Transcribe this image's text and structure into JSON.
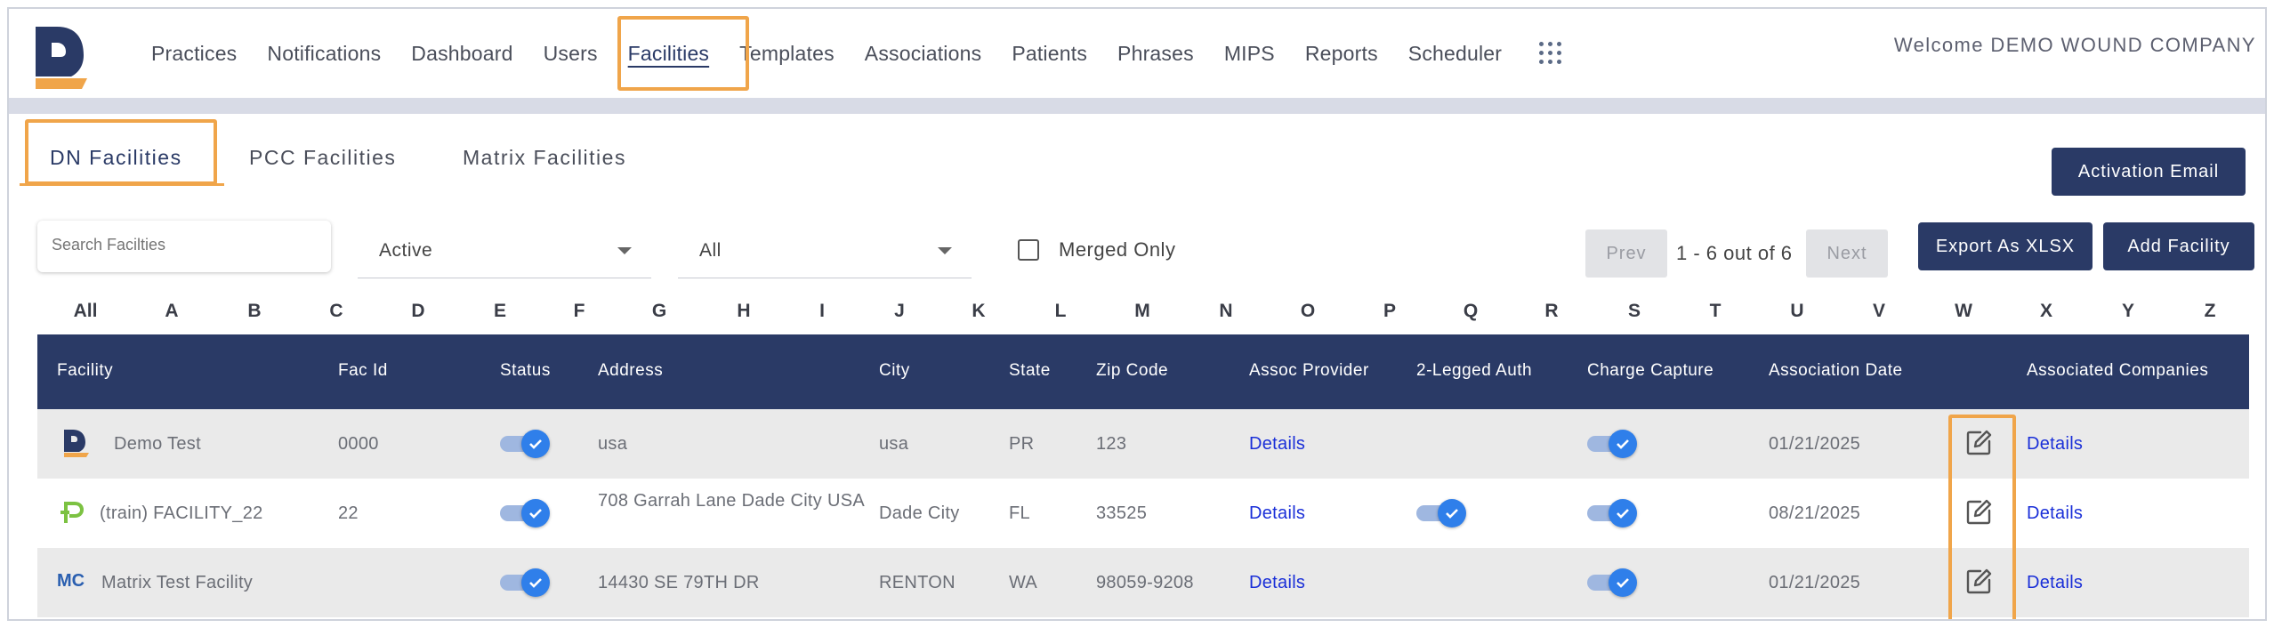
{
  "header": {
    "nav": [
      "Practices",
      "Notifications",
      "Dashboard",
      "Users",
      "Facilities",
      "Templates",
      "Associations",
      "Patients",
      "Phrases",
      "MIPS",
      "Reports",
      "Scheduler"
    ],
    "active_nav": "Facilities",
    "welcome": "Welcome DEMO WOUND COMPANY"
  },
  "tabs": [
    "DN Facilities",
    "PCC Facilities",
    "Matrix Facilities"
  ],
  "active_tab": "DN Facilities",
  "buttons": {
    "activation_email": "Activation Email",
    "export": "Export As XLSX",
    "add_facility": "Add Facility",
    "prev": "Prev",
    "next": "Next"
  },
  "filters": {
    "search_placeholder": "Search Facilties",
    "status_value": "Active",
    "type_value": "All",
    "merged_label": "Merged Only",
    "merged_checked": false
  },
  "pagination": {
    "text": "1 - 6 out of 6"
  },
  "letters": [
    "All",
    "A",
    "B",
    "C",
    "D",
    "E",
    "F",
    "G",
    "H",
    "I",
    "J",
    "K",
    "L",
    "M",
    "N",
    "O",
    "P",
    "Q",
    "R",
    "S",
    "T",
    "U",
    "V",
    "W",
    "X",
    "Y",
    "Z"
  ],
  "table": {
    "columns": [
      "Facility",
      "Fac Id",
      "Status",
      "Address",
      "City",
      "State",
      "Zip Code",
      "Assoc Provider",
      "2-Legged Auth",
      "Charge Capture",
      "Association Date",
      "Associated Companies"
    ],
    "rows": [
      {
        "icon": "dn-logo-icon",
        "facility": "Demo Test",
        "fac_id": "0000",
        "status": true,
        "address": "usa",
        "city": "usa",
        "state": "PR",
        "zip": "123",
        "assoc_provider": "Details",
        "two_legged_auth": false,
        "charge_capture": true,
        "association_date": "01/21/2025",
        "associated_companies": "Details"
      },
      {
        "icon": "pcc-logo-icon",
        "facility": "(train) FACILITY_22",
        "fac_id": "22",
        "status": true,
        "address": "708 Garrah Lane Dade City USA",
        "city": "Dade City",
        "state": "FL",
        "zip": "33525",
        "assoc_provider": "Details",
        "two_legged_auth": true,
        "charge_capture": true,
        "association_date": "08/21/2025",
        "associated_companies": "Details"
      },
      {
        "icon": "matrix-logo-icon",
        "icon_text": "MC",
        "facility": "Matrix Test Facility",
        "fac_id": "",
        "status": true,
        "address": "14430 SE 79TH DR",
        "city": "RENTON",
        "state": "WA",
        "zip": "98059-9208",
        "assoc_provider": "Details",
        "two_legged_auth": false,
        "charge_capture": true,
        "association_date": "01/21/2025",
        "associated_companies": "Details"
      }
    ]
  },
  "colors": {
    "navy": "#2a3a66",
    "highlight": "#f0a54a",
    "toggle": "#2f7fea",
    "link": "#1a2fd8"
  }
}
